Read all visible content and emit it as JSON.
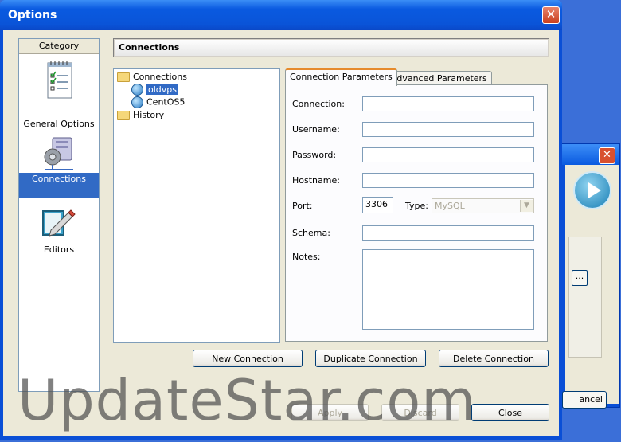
{
  "window": {
    "title": "Options",
    "close_glyph": "✕"
  },
  "background_window": {
    "close_glyph": "✕",
    "browse_label": "...",
    "cancel_label": "ancel"
  },
  "category": {
    "header": "Category",
    "items": [
      {
        "label": "General Options",
        "icon": "notepad-icon"
      },
      {
        "label": "Connections",
        "icon": "server-icon",
        "selected": true
      },
      {
        "label": "Editors",
        "icon": "pencil-icon"
      }
    ]
  },
  "section_title": "Connections",
  "tree": {
    "root": "Connections",
    "children": [
      "oldvps",
      "CentOS5"
    ],
    "history": "History"
  },
  "tabs": {
    "connection": "Connection Parameters",
    "advanced": "Advanced Parameters"
  },
  "form": {
    "connection_label": "Connection:",
    "username_label": "Username:",
    "password_label": "Password:",
    "hostname_label": "Hostname:",
    "port_label": "Port:",
    "port_value": "3306",
    "type_label": "Type:",
    "type_value": "MySQL",
    "schema_label": "Schema:",
    "notes_label": "Notes:"
  },
  "buttons": {
    "new": "New Connection",
    "duplicate": "Duplicate Connection",
    "delete": "Delete Connection",
    "apply": "Apply",
    "discard": "Discard",
    "close": "Close"
  },
  "watermark": "UpdateStar.com",
  "colors": {
    "selection": "#316ac5",
    "titlebar": "#0a5ae0",
    "face": "#ece9d8"
  }
}
